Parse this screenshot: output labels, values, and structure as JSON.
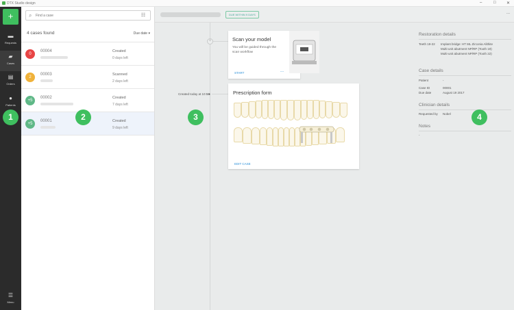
{
  "window": {
    "title": "DTX Studio design"
  },
  "rail": {
    "new_label": "+",
    "items": [
      {
        "label": "Requests",
        "icon": "inbox-icon"
      },
      {
        "label": "Cases",
        "icon": "folder-icon"
      },
      {
        "label": "Orders",
        "icon": "cart-icon"
      },
      {
        "label": "Patients",
        "icon": "people-icon"
      },
      {
        "label": "Menu",
        "icon": "menu-icon"
      }
    ]
  },
  "search": {
    "placeholder": "Find a case"
  },
  "list": {
    "found": "4 cases found",
    "sort": "Due date",
    "cases": [
      {
        "avatar": "0",
        "avatar_color": "#e84545",
        "id": "00004",
        "status": "Created",
        "days": "0 days left"
      },
      {
        "avatar": "2",
        "avatar_color": "#f0b23a",
        "id": "00003",
        "status": "Scanned",
        "days": "2 days left"
      },
      {
        "avatar": "+5",
        "avatar_color": "#5fb887",
        "id": "00002",
        "status": "Created",
        "days": "7 days left"
      },
      {
        "avatar": "+5",
        "avatar_color": "#5fb887",
        "id": "00001",
        "status": "Created",
        "days": "9 days left"
      }
    ]
  },
  "main": {
    "due_badge": "DUE WITHIN 9 DAYS",
    "more": "...",
    "created": "Created today at 10:58",
    "scan_card": {
      "title": "Scan your model",
      "text1": "You will be guided through the",
      "text2": "scan workflow",
      "action": "START",
      "more": "..."
    },
    "rx_card": {
      "title": "Prescription form",
      "action": "EDIT CASE"
    }
  },
  "details": {
    "restoration_title": "Restoration details",
    "teeth_label": "Teeth 19-22",
    "restoration_lines": [
      "Implant bridge: HT ML Zirconia Alithite",
      "Multi-unit abutment NP/RP (Tooth 19)",
      "Multi-unit abutment NP/RP (Tooth 22)"
    ],
    "case_title": "Case details",
    "patient_label": "Patient",
    "patient_value": "-",
    "caseid_label": "Case ID",
    "caseid_value": "00001",
    "duedate_label": "Due date",
    "duedate_value": "August 19 2017",
    "clinician_title": "Clinician details",
    "requested_label": "Requested by",
    "requested_value": "Nobel",
    "notes_title": "Notes",
    "notes_value": "-"
  },
  "callouts": [
    "1",
    "2",
    "3",
    "4"
  ]
}
